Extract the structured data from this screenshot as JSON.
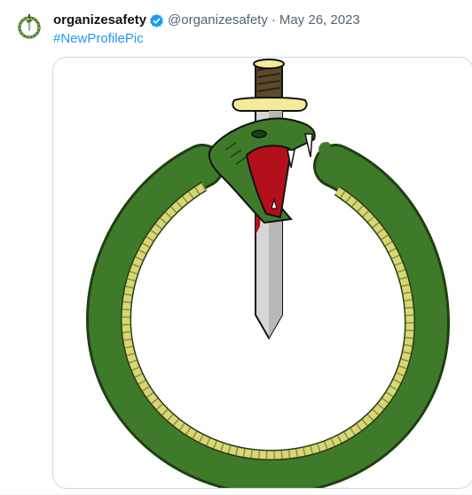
{
  "tweet": {
    "display_name": "organizesafety",
    "handle": "@organizesafety",
    "separator": "·",
    "date": "May 26, 2023",
    "hashtag": "#NewProfilePic"
  },
  "icons": {
    "verified": "verified-badge-icon",
    "avatar": "snake-dagger-logo",
    "media": "snake-dagger-image"
  },
  "colors": {
    "link": "#1d9bf0",
    "verified": "#1d9bf0",
    "muted": "#536471",
    "snake_green": "#3f7a2b",
    "snake_belly": "#d8d675",
    "blade": "#c9c9c9",
    "hilt": "#f3eb9a",
    "blood": "#b3101b"
  }
}
